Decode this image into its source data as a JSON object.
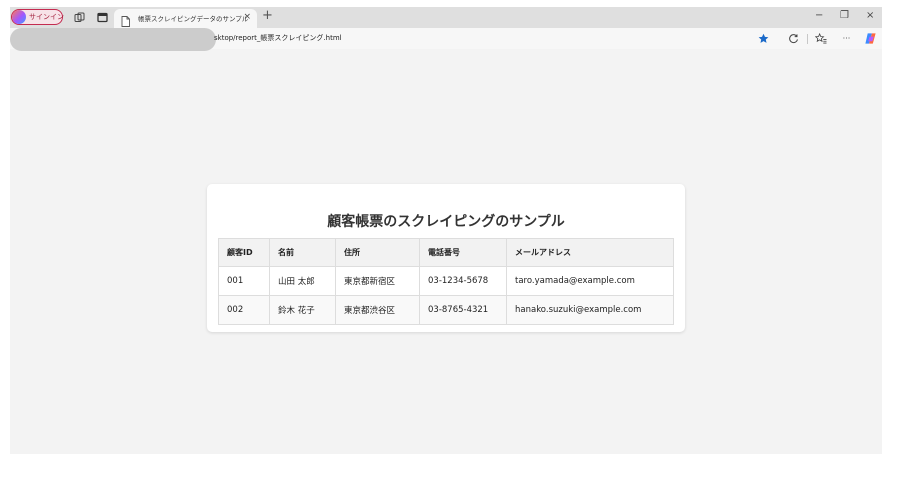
{
  "browser": {
    "signin_label": "サインイン",
    "tab_title": "帳票スクレイピングデータのサンプル",
    "tab_close": "×",
    "new_tab": "+",
    "window": {
      "minimize": "−",
      "restore": "❐",
      "close": "×"
    },
    "address_text": "sktop/report_帳票スクレイピング.html",
    "more_label": "···"
  },
  "page": {
    "title": "顧客帳票のスクレイピングのサンプル",
    "table": {
      "headers": [
        "顧客ID",
        "名前",
        "住所",
        "電話番号",
        "メールアドレス"
      ],
      "rows": [
        [
          "001",
          "山田 太郎",
          "東京都新宿区",
          "03-1234-5678",
          "taro.yamada@example.com"
        ],
        [
          "002",
          "鈴木 花子",
          "東京都渋谷区",
          "03-8765-4321",
          "hanako.suzuki@example.com"
        ]
      ]
    }
  },
  "colors": {
    "accent": "#1b6ac9",
    "signin_border": "#c42b50"
  }
}
